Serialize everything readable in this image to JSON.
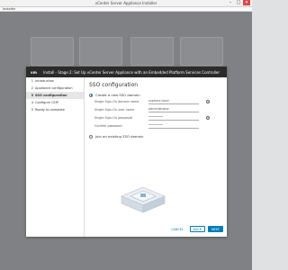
{
  "window": {
    "title": "vCenter Server Appliance Installer",
    "menu_label": "Installer",
    "min_glyph": "–",
    "max_glyph": "□",
    "close_glyph": "✕"
  },
  "dialog": {
    "logo": "vm",
    "title": "Install - Stage 2: Set Up vCenter Server Appliance with an Embedded Platform Services Controller",
    "steps": [
      {
        "num": "1",
        "label": "Introduction"
      },
      {
        "num": "2",
        "label": "Appliance configuration"
      },
      {
        "num": "3",
        "label": "SSO configuration"
      },
      {
        "num": "4",
        "label": "Configure CEIP"
      },
      {
        "num": "5",
        "label": "Ready to complete"
      }
    ],
    "active_step_index": 2,
    "section_title": "SSO configuration",
    "options": {
      "create_label": "Create a new SSO domain",
      "join_label": "Join an existing SSO domain"
    },
    "fields": [
      {
        "label": "Single Sign-On domain name",
        "value": "vsphere.local"
      },
      {
        "label": "Single Sign-On user name",
        "value": "administrator"
      },
      {
        "label": "Single Sign-On password",
        "value": "••••••••"
      },
      {
        "label": "Confirm password",
        "value": "••••••••"
      }
    ],
    "buttons": {
      "cancel": "CANCEL",
      "back": "BACK",
      "next": "NEXT"
    }
  },
  "colors": {
    "accent": "#007cbb",
    "header_bg": "#2b2b2b",
    "overlay_bg": "#7f8184"
  }
}
